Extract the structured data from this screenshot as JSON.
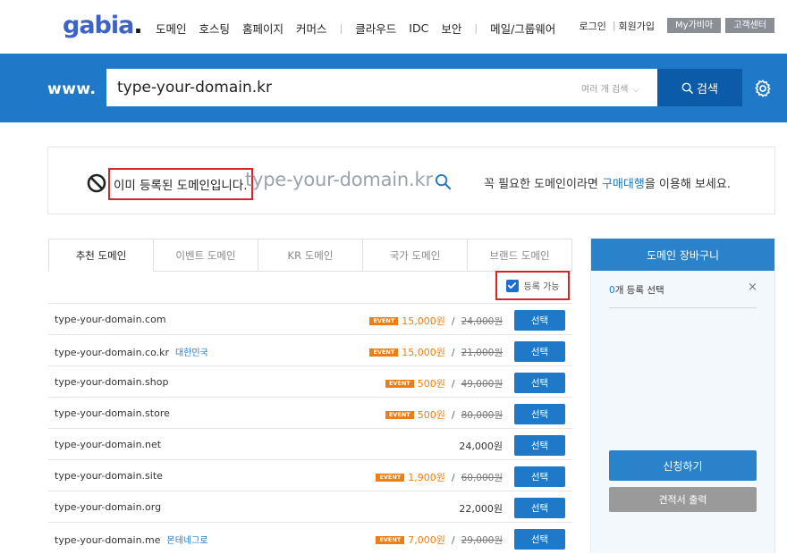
{
  "header": {
    "logo": "gabia",
    "logo_dot": ".",
    "nav": [
      "도메인",
      "호스팅",
      "홈페이지",
      "커머스",
      "클라우드",
      "IDC",
      "보안",
      "메일/그룹웨어"
    ],
    "nav_separator": "|",
    "util_login": "로그인",
    "util_separator": "|",
    "util_signup": "회원가입",
    "util_mygabia": "My가비아",
    "util_support": "고객센터"
  },
  "search": {
    "prefix": "www.",
    "value": "type-your-domain.kr",
    "multi_search": "여러 개 검색",
    "button_label": "검색"
  },
  "result": {
    "registered_msg": "이미 등록된 도메인입니다.",
    "query": "type-your-domain.kr",
    "buy_prefix": "꼭 필요한 도메인이라면 ",
    "buy_link": "구매대행",
    "buy_suffix": "을 이용해 보세요."
  },
  "tabs": [
    "추천 도메인",
    "이벤트 도메인",
    "KR 도메인",
    "국가 도메인",
    "브랜드 도메인"
  ],
  "filter": {
    "label": "등록 가능",
    "checked": true
  },
  "rows": [
    {
      "domain": "type-your-domain.com",
      "region": "",
      "event": "EVENT",
      "sale": "15,000원",
      "slash": "/",
      "orig": "24,000원",
      "price": "",
      "select": "선택"
    },
    {
      "domain": "type-your-domain.co.kr",
      "region": "대한민국",
      "event": "EVENT",
      "sale": "15,000원",
      "slash": "/",
      "orig": "21,000원",
      "price": "",
      "select": "선택"
    },
    {
      "domain": "type-your-domain.shop",
      "region": "",
      "event": "EVENT",
      "sale": "500원",
      "slash": "/",
      "orig": "49,000원",
      "price": "",
      "select": "선택"
    },
    {
      "domain": "type-your-domain.store",
      "region": "",
      "event": "EVENT",
      "sale": "500원",
      "slash": "/",
      "orig": "80,000원",
      "price": "",
      "select": "선택"
    },
    {
      "domain": "type-your-domain.net",
      "region": "",
      "event": "",
      "sale": "",
      "slash": "",
      "orig": "",
      "price": "24,000원",
      "select": "선택"
    },
    {
      "domain": "type-your-domain.site",
      "region": "",
      "event": "EVENT",
      "sale": "1,900원",
      "slash": "/",
      "orig": "60,000원",
      "price": "",
      "select": "선택"
    },
    {
      "domain": "type-your-domain.org",
      "region": "",
      "event": "",
      "sale": "",
      "slash": "",
      "orig": "",
      "price": "22,000원",
      "select": "선택"
    },
    {
      "domain": "type-your-domain.me",
      "region": "몬테네그로",
      "event": "EVENT",
      "sale": "7,000원",
      "slash": "/",
      "orig": "29,000원",
      "price": "",
      "select": "선택"
    }
  ],
  "cart": {
    "title": "도메인 장바구니",
    "count": "0",
    "count_suffix": "개 등록 선택",
    "close": "×",
    "apply": "신청하기",
    "quote": "견적서 출력"
  },
  "colors": {
    "primary": "#1f78c8",
    "primary_dark": "#0b5ba8",
    "event": "#f07d11",
    "highlight": "#d8232a"
  }
}
